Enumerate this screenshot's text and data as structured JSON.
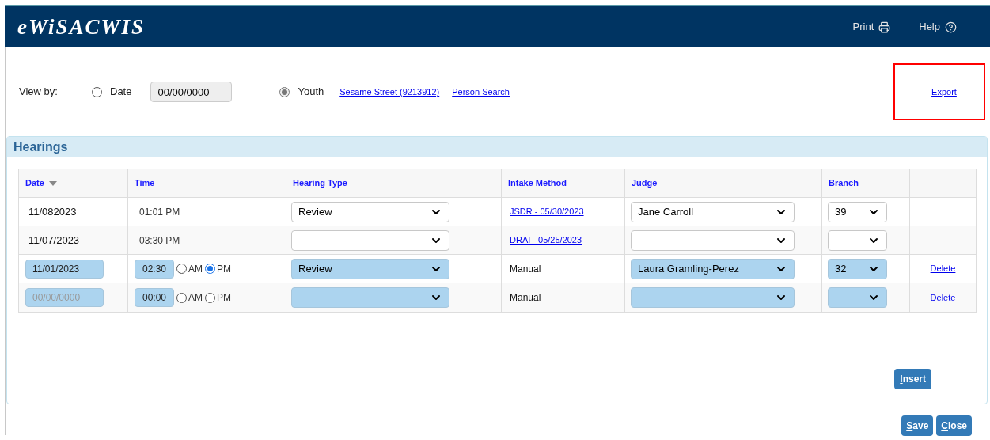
{
  "header": {
    "title": "eWiSACWIS",
    "links": [
      {
        "label": "Print",
        "kind": "print"
      },
      {
        "label": "Help",
        "kind": "help"
      }
    ]
  },
  "view_by": {
    "label": "View by:",
    "options": [
      {
        "label": "Date",
        "selected": false
      },
      {
        "label": "Youth",
        "selected": true
      }
    ],
    "date_field": {
      "value": "00/00/0000"
    },
    "links": [
      "Sesame Street (9213912)",
      "Person Search"
    ]
  },
  "export_link": {
    "label": "Export",
    "highlighted": true
  },
  "hearings": {
    "title": "Hearings",
    "columns": [
      {
        "label": "Date",
        "sorted": true
      },
      {
        "label": "Time",
        "sorted": false
      },
      {
        "label": "Hearing Type",
        "sorted": false
      },
      {
        "label": "Intake Method",
        "sorted": false
      },
      {
        "label": "Judge",
        "sorted": false
      },
      {
        "label": "Branch",
        "sorted": false
      }
    ],
    "rows": [
      {
        "kind": "saved",
        "date": "11/082023",
        "time": "01:01 PM",
        "hearing_type": "Review",
        "intake_method": "JSDR - 05/30/2023",
        "judge": "Jane Carroll",
        "branch": "39"
      },
      {
        "kind": "saved",
        "date": "11/07/2023",
        "time": "03:30 PM",
        "intake_method": "DRAI - 05/25/2023"
      },
      {
        "kind": "new",
        "date": {
          "value": "11/01/2023"
        },
        "time": "02:30",
        "periods": [
          {
            "label": "AM",
            "selected": false
          },
          {
            "label": "PM",
            "selected": true
          }
        ],
        "hearing_type": "Review",
        "intake_method": "Manual",
        "judge": "Laura Gramling-Perez",
        "branch": "32",
        "action": "Delete"
      },
      {
        "kind": "new",
        "date": {
          "placeholder": "00/00/0000"
        },
        "time": "00:00",
        "periods": [
          {
            "label": "AM",
            "selected": false
          },
          {
            "label": "PM",
            "selected": false
          }
        ],
        "intake_method": "Manual",
        "action": "Delete"
      }
    ],
    "insert_button": "Insert"
  },
  "buttons": [
    "Save",
    "Close"
  ]
}
